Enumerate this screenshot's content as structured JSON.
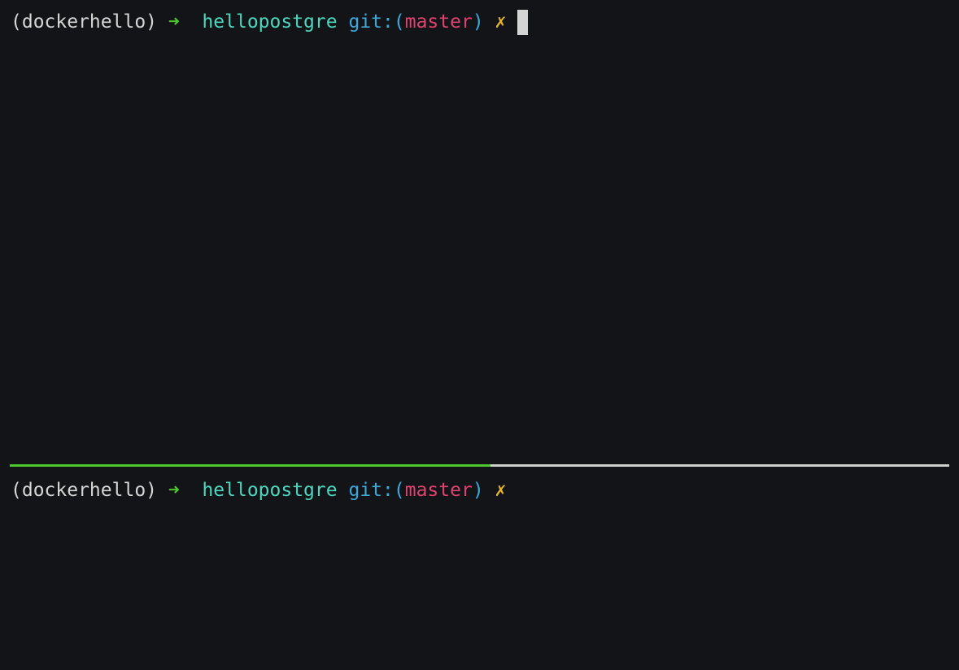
{
  "panes": [
    {
      "prompt": {
        "venv": "(dockerhello)",
        "arrow": "➜",
        "directory": "hellopostgre",
        "git_label": "git:(",
        "branch": "master",
        "git_close": ")",
        "dirty_mark": "✗"
      },
      "active": true
    },
    {
      "prompt": {
        "venv": "(dockerhello)",
        "arrow": "➜",
        "directory": "hellopostgre",
        "git_label": "git:(",
        "branch": "master",
        "git_close": ")",
        "dirty_mark": "✗"
      },
      "active": false
    }
  ],
  "divider": {
    "active_fraction": 0.512
  },
  "colors": {
    "background": "#121417",
    "text": "#d6d6d6",
    "arrow": "#4ec72f",
    "directory": "#4fd6be",
    "git_label": "#3fa8d8",
    "branch": "#e0426f",
    "dirty_mark": "#e8b52e",
    "divider_active": "#4ec72f",
    "divider_inactive": "#cfcfcf"
  }
}
